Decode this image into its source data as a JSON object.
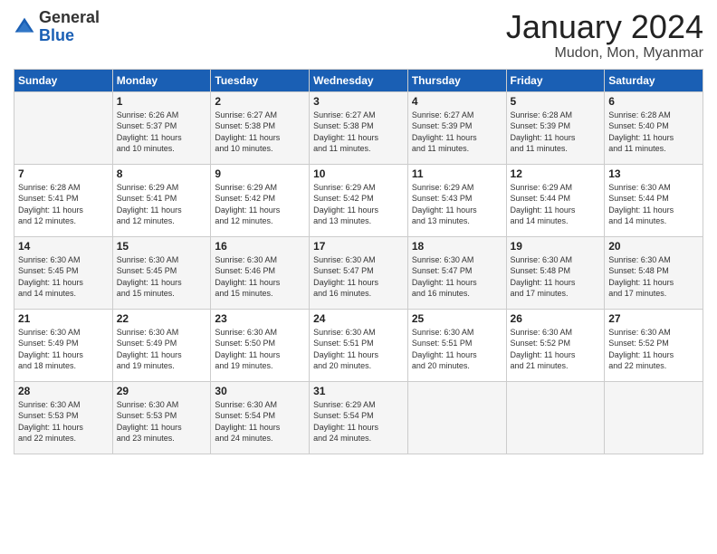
{
  "logo": {
    "general": "General",
    "blue": "Blue"
  },
  "title": "January 2024",
  "subtitle": "Mudon, Mon, Myanmar",
  "days_of_week": [
    "Sunday",
    "Monday",
    "Tuesday",
    "Wednesday",
    "Thursday",
    "Friday",
    "Saturday"
  ],
  "weeks": [
    [
      {
        "day": "",
        "info": ""
      },
      {
        "day": "1",
        "info": "Sunrise: 6:26 AM\nSunset: 5:37 PM\nDaylight: 11 hours\nand 10 minutes."
      },
      {
        "day": "2",
        "info": "Sunrise: 6:27 AM\nSunset: 5:38 PM\nDaylight: 11 hours\nand 10 minutes."
      },
      {
        "day": "3",
        "info": "Sunrise: 6:27 AM\nSunset: 5:38 PM\nDaylight: 11 hours\nand 11 minutes."
      },
      {
        "day": "4",
        "info": "Sunrise: 6:27 AM\nSunset: 5:39 PM\nDaylight: 11 hours\nand 11 minutes."
      },
      {
        "day": "5",
        "info": "Sunrise: 6:28 AM\nSunset: 5:39 PM\nDaylight: 11 hours\nand 11 minutes."
      },
      {
        "day": "6",
        "info": "Sunrise: 6:28 AM\nSunset: 5:40 PM\nDaylight: 11 hours\nand 11 minutes."
      }
    ],
    [
      {
        "day": "7",
        "info": "Sunrise: 6:28 AM\nSunset: 5:41 PM\nDaylight: 11 hours\nand 12 minutes."
      },
      {
        "day": "8",
        "info": "Sunrise: 6:29 AM\nSunset: 5:41 PM\nDaylight: 11 hours\nand 12 minutes."
      },
      {
        "day": "9",
        "info": "Sunrise: 6:29 AM\nSunset: 5:42 PM\nDaylight: 11 hours\nand 12 minutes."
      },
      {
        "day": "10",
        "info": "Sunrise: 6:29 AM\nSunset: 5:42 PM\nDaylight: 11 hours\nand 13 minutes."
      },
      {
        "day": "11",
        "info": "Sunrise: 6:29 AM\nSunset: 5:43 PM\nDaylight: 11 hours\nand 13 minutes."
      },
      {
        "day": "12",
        "info": "Sunrise: 6:29 AM\nSunset: 5:44 PM\nDaylight: 11 hours\nand 14 minutes."
      },
      {
        "day": "13",
        "info": "Sunrise: 6:30 AM\nSunset: 5:44 PM\nDaylight: 11 hours\nand 14 minutes."
      }
    ],
    [
      {
        "day": "14",
        "info": "Sunrise: 6:30 AM\nSunset: 5:45 PM\nDaylight: 11 hours\nand 14 minutes."
      },
      {
        "day": "15",
        "info": "Sunrise: 6:30 AM\nSunset: 5:45 PM\nDaylight: 11 hours\nand 15 minutes."
      },
      {
        "day": "16",
        "info": "Sunrise: 6:30 AM\nSunset: 5:46 PM\nDaylight: 11 hours\nand 15 minutes."
      },
      {
        "day": "17",
        "info": "Sunrise: 6:30 AM\nSunset: 5:47 PM\nDaylight: 11 hours\nand 16 minutes."
      },
      {
        "day": "18",
        "info": "Sunrise: 6:30 AM\nSunset: 5:47 PM\nDaylight: 11 hours\nand 16 minutes."
      },
      {
        "day": "19",
        "info": "Sunrise: 6:30 AM\nSunset: 5:48 PM\nDaylight: 11 hours\nand 17 minutes."
      },
      {
        "day": "20",
        "info": "Sunrise: 6:30 AM\nSunset: 5:48 PM\nDaylight: 11 hours\nand 17 minutes."
      }
    ],
    [
      {
        "day": "21",
        "info": "Sunrise: 6:30 AM\nSunset: 5:49 PM\nDaylight: 11 hours\nand 18 minutes."
      },
      {
        "day": "22",
        "info": "Sunrise: 6:30 AM\nSunset: 5:49 PM\nDaylight: 11 hours\nand 19 minutes."
      },
      {
        "day": "23",
        "info": "Sunrise: 6:30 AM\nSunset: 5:50 PM\nDaylight: 11 hours\nand 19 minutes."
      },
      {
        "day": "24",
        "info": "Sunrise: 6:30 AM\nSunset: 5:51 PM\nDaylight: 11 hours\nand 20 minutes."
      },
      {
        "day": "25",
        "info": "Sunrise: 6:30 AM\nSunset: 5:51 PM\nDaylight: 11 hours\nand 20 minutes."
      },
      {
        "day": "26",
        "info": "Sunrise: 6:30 AM\nSunset: 5:52 PM\nDaylight: 11 hours\nand 21 minutes."
      },
      {
        "day": "27",
        "info": "Sunrise: 6:30 AM\nSunset: 5:52 PM\nDaylight: 11 hours\nand 22 minutes."
      }
    ],
    [
      {
        "day": "28",
        "info": "Sunrise: 6:30 AM\nSunset: 5:53 PM\nDaylight: 11 hours\nand 22 minutes."
      },
      {
        "day": "29",
        "info": "Sunrise: 6:30 AM\nSunset: 5:53 PM\nDaylight: 11 hours\nand 23 minutes."
      },
      {
        "day": "30",
        "info": "Sunrise: 6:30 AM\nSunset: 5:54 PM\nDaylight: 11 hours\nand 24 minutes."
      },
      {
        "day": "31",
        "info": "Sunrise: 6:29 AM\nSunset: 5:54 PM\nDaylight: 11 hours\nand 24 minutes."
      },
      {
        "day": "",
        "info": ""
      },
      {
        "day": "",
        "info": ""
      },
      {
        "day": "",
        "info": ""
      }
    ]
  ]
}
